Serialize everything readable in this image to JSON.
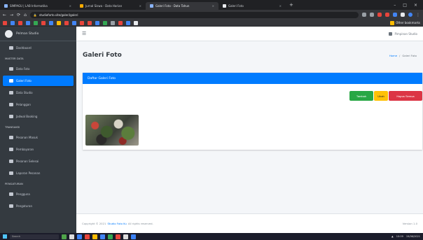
{
  "browser": {
    "tabs": [
      {
        "title": "SIMPAGU | LAB Informatika",
        "active": false
      },
      {
        "title": "Jurnal Siswa - Data Harian",
        "active": false
      },
      {
        "title": "Galeri Foto - Data Tahun",
        "active": true
      },
      {
        "title": "Galeri Foto",
        "active": false
      }
    ],
    "new_tab": "+",
    "url": "studioforto.site/galeri/galeri",
    "window_controls": [
      "–",
      "□",
      "×"
    ],
    "bookmarks_label": "Other bookmarks"
  },
  "sidebar": {
    "brand": "Pelman Studio",
    "items": [
      {
        "label": "Dashboard",
        "type": "item"
      },
      {
        "label": "MASTER DATA",
        "type": "header"
      },
      {
        "label": "Data Foto",
        "type": "item"
      },
      {
        "label": "Galeri Foto",
        "type": "item",
        "active": true
      },
      {
        "label": "Data Studio",
        "type": "item"
      },
      {
        "label": "Pelanggan",
        "type": "item"
      },
      {
        "label": "Jadwal Booking",
        "type": "item"
      },
      {
        "label": "TRANSAKSI",
        "type": "header"
      },
      {
        "label": "Pesanan Masuk",
        "type": "item"
      },
      {
        "label": "Pembayaran",
        "type": "item"
      },
      {
        "label": "Pesanan Selesai",
        "type": "item"
      },
      {
        "label": "Laporan Pesanan",
        "type": "item"
      },
      {
        "label": "PENGATURAN",
        "type": "header"
      },
      {
        "label": "Pengguna",
        "type": "item"
      },
      {
        "label": "Pengaturan",
        "type": "item"
      }
    ]
  },
  "topnav": {
    "menu_icon": "☰",
    "user": "Pimpinan Studio"
  },
  "content": {
    "title": "Galeri Foto",
    "breadcrumb_home": "Home",
    "breadcrumb_current": "Galeri Foto",
    "card_title": "Daftar Galeri Foto",
    "buttons": {
      "add": "Tambah",
      "edit": "Ubah",
      "delete": "Hapus Semua"
    }
  },
  "footer": {
    "copyright_prefix": "Copyright © 2021",
    "brand_link": "Studio Foto Ku",
    "rights": "All rights reserved.",
    "version": "Version 1.0"
  },
  "taskbar": {
    "search_placeholder": "Search",
    "time": "10:09",
    "date": "19/06/2021"
  },
  "colors": {
    "primary": "#007bff",
    "success": "#28a745",
    "warning": "#ffc107",
    "danger": "#dc3545",
    "sidebar_bg": "#343a40"
  }
}
